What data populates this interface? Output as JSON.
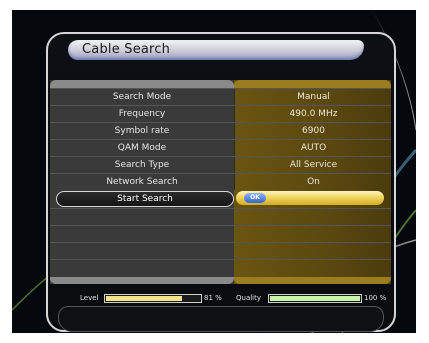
{
  "screen": {
    "title": "Cable Search"
  },
  "settings": [
    {
      "label": "Search Mode",
      "value": "Manual"
    },
    {
      "label": "Frequency",
      "value": "490.0 MHz"
    },
    {
      "label": "Symbol rate",
      "value": "6900"
    },
    {
      "label": "QAM Mode",
      "value": "AUTO"
    },
    {
      "label": "Search Type",
      "value": "All Service"
    },
    {
      "label": "Network Search",
      "value": "On"
    }
  ],
  "start": {
    "label": "Start Search",
    "ok_label": "OK"
  },
  "signal": {
    "level_label": "Level",
    "level_value": "81 %",
    "level_fraction": 0.81,
    "quality_label": "Quality",
    "quality_value": "100 %",
    "quality_fraction": 1.0
  },
  "colors": {
    "highlight": "#f0d560",
    "value_panel": "#6a5510",
    "level_fill": "#f3e487",
    "quality_fill": "#c9f5a6"
  }
}
